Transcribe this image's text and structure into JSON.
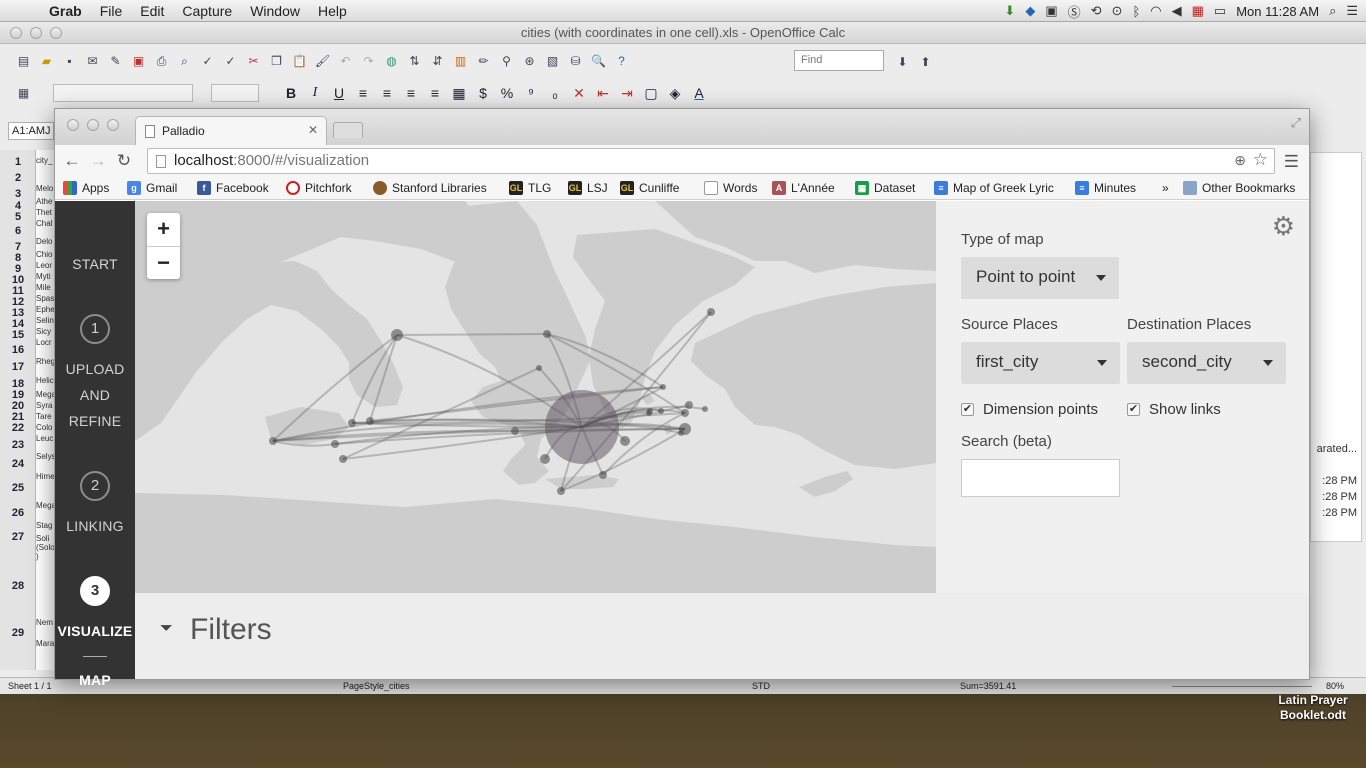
{
  "menubar": {
    "app": "Grab",
    "items": [
      "File",
      "Edit",
      "Capture",
      "Window",
      "Help"
    ],
    "clock": "Mon 11:28 AM"
  },
  "calc": {
    "title": "cities (with coordinates in one cell).xls - OpenOffice Calc",
    "find_placeholder": "Find",
    "namebox": "A1:AMJ",
    "rows": [
      "1",
      "2",
      "3",
      "4",
      "5",
      "6",
      "7",
      "8",
      "9",
      "10",
      "11",
      "12",
      "13",
      "14",
      "15",
      "16",
      "17",
      "18",
      "19",
      "20",
      "21",
      "22",
      "23",
      "24",
      "25",
      "26",
      "27",
      "28",
      "29"
    ],
    "cells": [
      "city_",
      "Melo",
      "Athe",
      "Thet",
      "Chal",
      "Delo",
      "Chio",
      "Leor",
      "Myti",
      "Mile",
      "Spas",
      "Ephe",
      "Selin",
      "Sicy",
      "Locr",
      "Rheg",
      "Helic",
      "Mega",
      "Syra",
      "Tare",
      "Colo",
      "Leuc",
      "Selys",
      "Hime",
      "Mega",
      "Stag",
      "Soli",
      "(Solo",
      ")",
      "Nem",
      "Mara"
    ],
    "status": {
      "sheet": "Sheet 1 / 1",
      "style": "PageStyle_cities",
      "mode": "STD",
      "sum": "Sum=3591.41",
      "zoom": "80%"
    },
    "side_texts": [
      "arated...",
      ":28 PM",
      ":28 PM",
      ":28 PM"
    ]
  },
  "desktop": {
    "file_label": "Latin Prayer Booklet.odt"
  },
  "browser": {
    "tab_title": "Palladio",
    "url_host": "localhost",
    "url_path": ":8000/#/visualization",
    "bookmarks": [
      "Apps",
      "Gmail",
      "Facebook",
      "Pitchfork",
      "Stanford Libraries",
      "TLG",
      "LSJ",
      "Cunliffe",
      "Words",
      "L'Année",
      "Dataset",
      "Map of Greek Lyric",
      "Minutes"
    ],
    "bookmarks_overflow": "»",
    "other_bookmarks": "Other Bookmarks"
  },
  "palladio": {
    "nav": {
      "start": "START",
      "step1_num": "1",
      "step1_lines": [
        "UPLOAD",
        "AND",
        "REFINE"
      ],
      "step2_num": "2",
      "step2_label": "LINKING",
      "step3_num": "3",
      "step3_label": "VISUALIZE",
      "step3_sub": "MAP"
    },
    "zoom_in": "+",
    "zoom_out": "−",
    "settings": {
      "type_label": "Type of map",
      "type_value": "Point to point",
      "source_label": "Source Places",
      "source_value": "first_city",
      "dest_label": "Destination Places",
      "dest_value": "second_city",
      "dim_points_label": "Dimension points",
      "dim_points_checked": true,
      "show_links_label": "Show links",
      "show_links_checked": true,
      "search_label": "Search (beta)",
      "search_value": ""
    },
    "filters_label": "Filters"
  }
}
